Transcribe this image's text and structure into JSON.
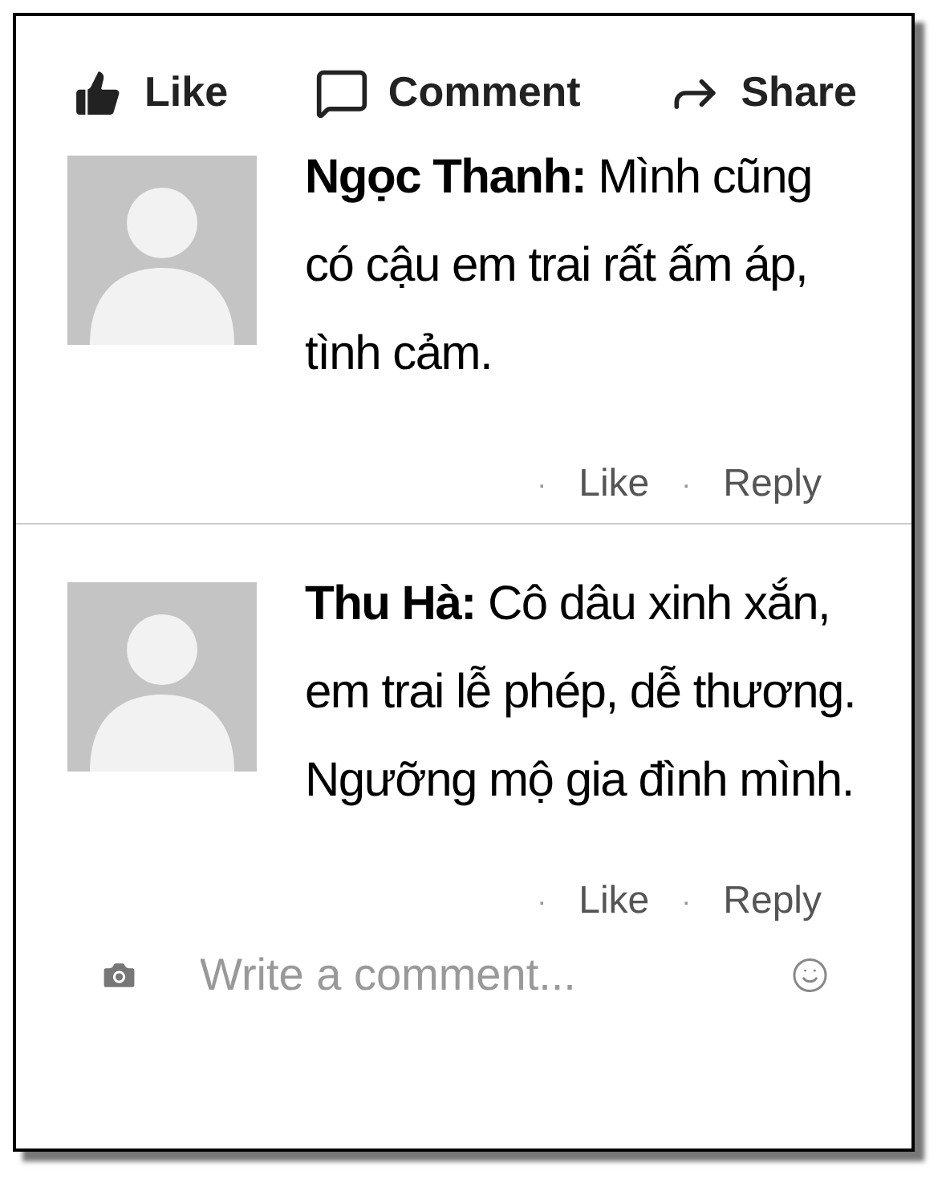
{
  "actions": [
    {
      "kind": "like",
      "label": "Like"
    },
    {
      "kind": "comment",
      "label": "Comment"
    },
    {
      "kind": "share",
      "label": "Share"
    }
  ],
  "comments": [
    {
      "author": "Ngọc Thanh:",
      "text": "Mình cũng có cậu em trai rất ấm áp, tình cảm.",
      "links": [
        {
          "dot": "·",
          "label": "Like"
        },
        {
          "dot": "·",
          "label": "Reply"
        }
      ]
    },
    {
      "author": "Thu Hà:",
      "text": "Cô dâu xinh xắn, em trai lễ phép, dễ thương. Ngưỡng mộ gia đình mình.",
      "links": [
        {
          "dot": "·",
          "label": "Like"
        },
        {
          "dot": "·",
          "label": "Reply"
        }
      ]
    }
  ],
  "composer": {
    "placeholder": "Write a comment..."
  }
}
